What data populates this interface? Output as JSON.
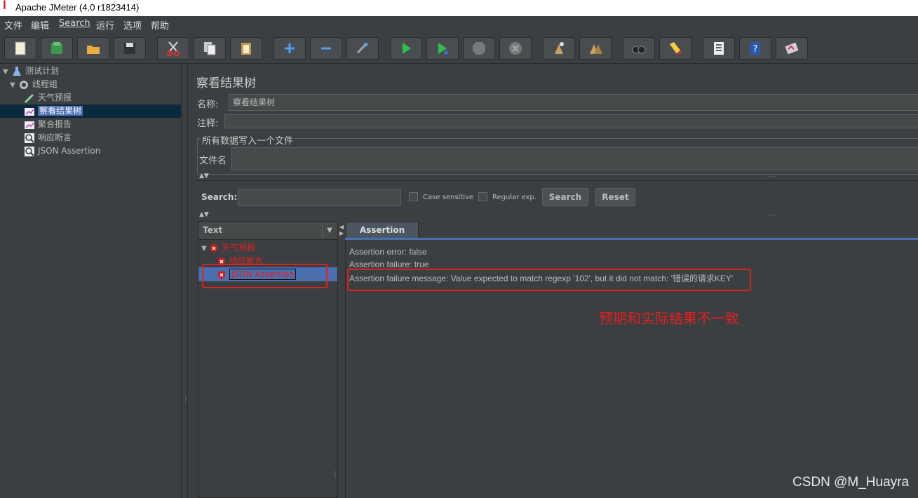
{
  "window": {
    "title": "Apache JMeter (4.0 r1823414)"
  },
  "menu": [
    "文件",
    "编辑",
    "Search",
    "运行",
    "选项",
    "帮助"
  ],
  "toolbar": {
    "icons": [
      "new-icon",
      "templates-icon",
      "open-icon",
      "save-icon",
      "cut-icon",
      "copy-icon",
      "paste-icon",
      "expand-icon",
      "collapse-icon",
      "toggle-icon",
      "start-icon",
      "start-no-pause-icon",
      "stop-icon",
      "shutdown-icon",
      "clear-icon",
      "clear-all-icon",
      "search-icon",
      "reset-search-icon",
      "function-helper-icon",
      "help-icon",
      "logger-icon"
    ]
  },
  "tree": {
    "items": [
      {
        "label": "测试计划",
        "icon": "test-plan-icon"
      },
      {
        "label": "线程组",
        "icon": "thread-group-icon"
      },
      {
        "label": "天气预报",
        "icon": "sampler-icon"
      },
      {
        "label": "察看结果树",
        "icon": "listener-icon",
        "selected": true
      },
      {
        "label": "聚合报告",
        "icon": "listener-icon"
      },
      {
        "label": "响应断言",
        "icon": "assertion-icon"
      },
      {
        "label": "JSON Assertion",
        "icon": "assertion-icon"
      }
    ]
  },
  "panel": {
    "title": "察看结果树",
    "name_label": "名称:",
    "name_value": "察看结果树",
    "comment_label": "注释:",
    "file_group_label": "所有数据写入一个文件",
    "file_label": "文件名"
  },
  "search": {
    "label": "Search:",
    "case_sensitive": "Case sensitive",
    "regex": "Regular exp.",
    "search_button": "Search",
    "reset_button": "Reset"
  },
  "results": {
    "renderer": "Text",
    "tree": [
      {
        "label": "天气预报",
        "status": "error"
      },
      {
        "label": "响应断言",
        "status": "error"
      },
      {
        "label": "JSON Assertion",
        "status": "error",
        "selected": true
      }
    ],
    "tab": "Assertion result",
    "lines": [
      "Assertion error: false",
      "Assertion failure: true",
      "Assertion failure message: Value expected to match regexp '102', but it did not match: '错误的请求KEY'"
    ]
  },
  "annotation": "预期和实际结果不一致",
  "watermark": "CSDN @M_Huayra",
  "colors": {
    "accent": "#4b6eaf",
    "error": "#e02020",
    "background": "#3c3f41"
  }
}
